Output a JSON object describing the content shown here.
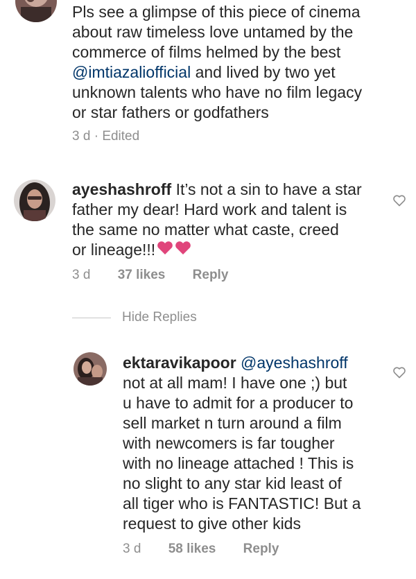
{
  "comments": [
    {
      "username": "",
      "lines": [
        "Pls see a glimpse of this piece of cinema",
        "about raw timeless love untamed by the",
        "commerce of films helmed by the best",
        "@imtiazaliofficial and lived by two yet",
        "unknown talents who have no film legacy",
        "or star fathers or godfathers"
      ],
      "mention": "@imtiazaliofficial",
      "time": "3 d",
      "edited": "Edited",
      "separator": "·"
    },
    {
      "username": "ayeshashroff",
      "lines": [
        "It’s not a sin to have a star",
        "father my dear! Hard work and talent is",
        "the same no matter what caste, creed",
        "or lineage!!!"
      ],
      "time": "3 d",
      "likes": "37 likes",
      "reply": "Reply",
      "emoji": "two-pink-hearts"
    },
    {
      "username": "ektaravikapoor",
      "mention": "@ayeshashroff",
      "lines": [
        "not at all mam! I have one ;) but",
        "u have to admit for a producer to",
        "sell market n turn around a film",
        "with newcomers is far tougher",
        "with no lineage attached ! This is",
        "no slight to any star kid least of",
        "all tiger who is FANTASTIC! But a",
        "request to give other kids"
      ],
      "time": "3 d",
      "likes": "58 likes",
      "reply": "Reply"
    }
  ],
  "hide_replies": "Hide Replies",
  "colors": {
    "text": "#262626",
    "muted": "#8e8e8e",
    "mention": "#003569",
    "heart_emoji": "#e0457b"
  }
}
